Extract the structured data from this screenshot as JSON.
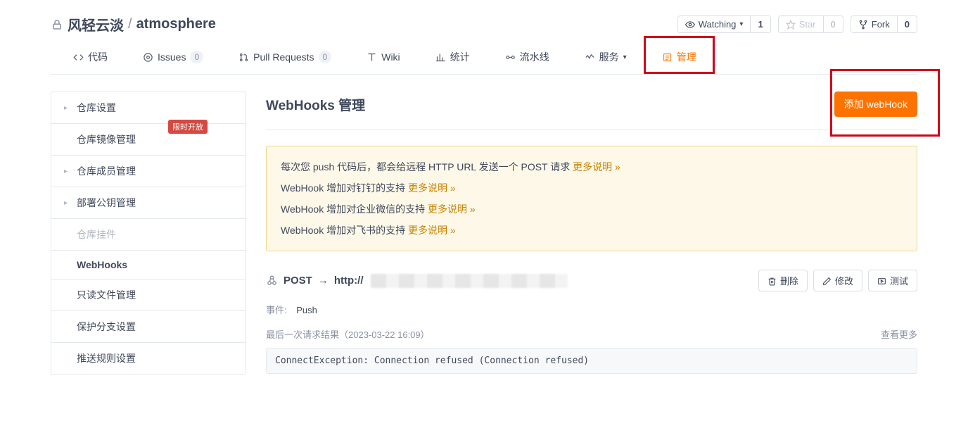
{
  "repo": {
    "owner": "风轻云淡",
    "sep": "/",
    "name": "atmosphere"
  },
  "repoActions": {
    "watch": {
      "label": "Watching",
      "count": "1"
    },
    "star": {
      "label": "Star",
      "count": "0"
    },
    "fork": {
      "label": "Fork",
      "count": "0"
    }
  },
  "tabs": {
    "code": "代码",
    "issues": {
      "label": "Issues",
      "count": "0"
    },
    "pr": {
      "label": "Pull Requests",
      "count": "0"
    },
    "wiki": "Wiki",
    "stats": "统计",
    "pipeline": "流水线",
    "service": "服务",
    "manage": "管理"
  },
  "sidebar": {
    "repoSettings": "仓库设置",
    "mirror": "仓库镜像管理",
    "mirrorTag": "限时开放",
    "members": "仓库成员管理",
    "deployKeys": "部署公钥管理",
    "hooksLabel": "仓库挂件",
    "webhooks": "WebHooks",
    "readonly": "只读文件管理",
    "protect": "保护分支设置",
    "pushRules": "推送规则设置"
  },
  "page": {
    "title": "WebHooks 管理",
    "addBtn": "添加 webHook"
  },
  "notice": {
    "l1a": "每次您 push 代码后，都会给远程 HTTP URL 发送一个 POST 请求 ",
    "l1b": "更多说明 »",
    "l2a": "WebHook 增加对钉钉的支持 ",
    "l2b": "更多说明 »",
    "l3a": "WebHook 增加对企业微信的支持 ",
    "l3b": "更多说明 »",
    "l4a": "WebHook 增加对飞书的支持 ",
    "l4b": "更多说明 »"
  },
  "hook": {
    "method": "POST",
    "arrow": "→",
    "urlPrefix": "http://",
    "delete": "删除",
    "edit": "修改",
    "test": "测试",
    "eventLabel": "事件:",
    "eventValue": "Push",
    "lastLabel": "最后一次请求结果（2023-03-22 16:09）",
    "more": "查看更多",
    "result": "ConnectException: Connection refused (Connection refused)"
  }
}
